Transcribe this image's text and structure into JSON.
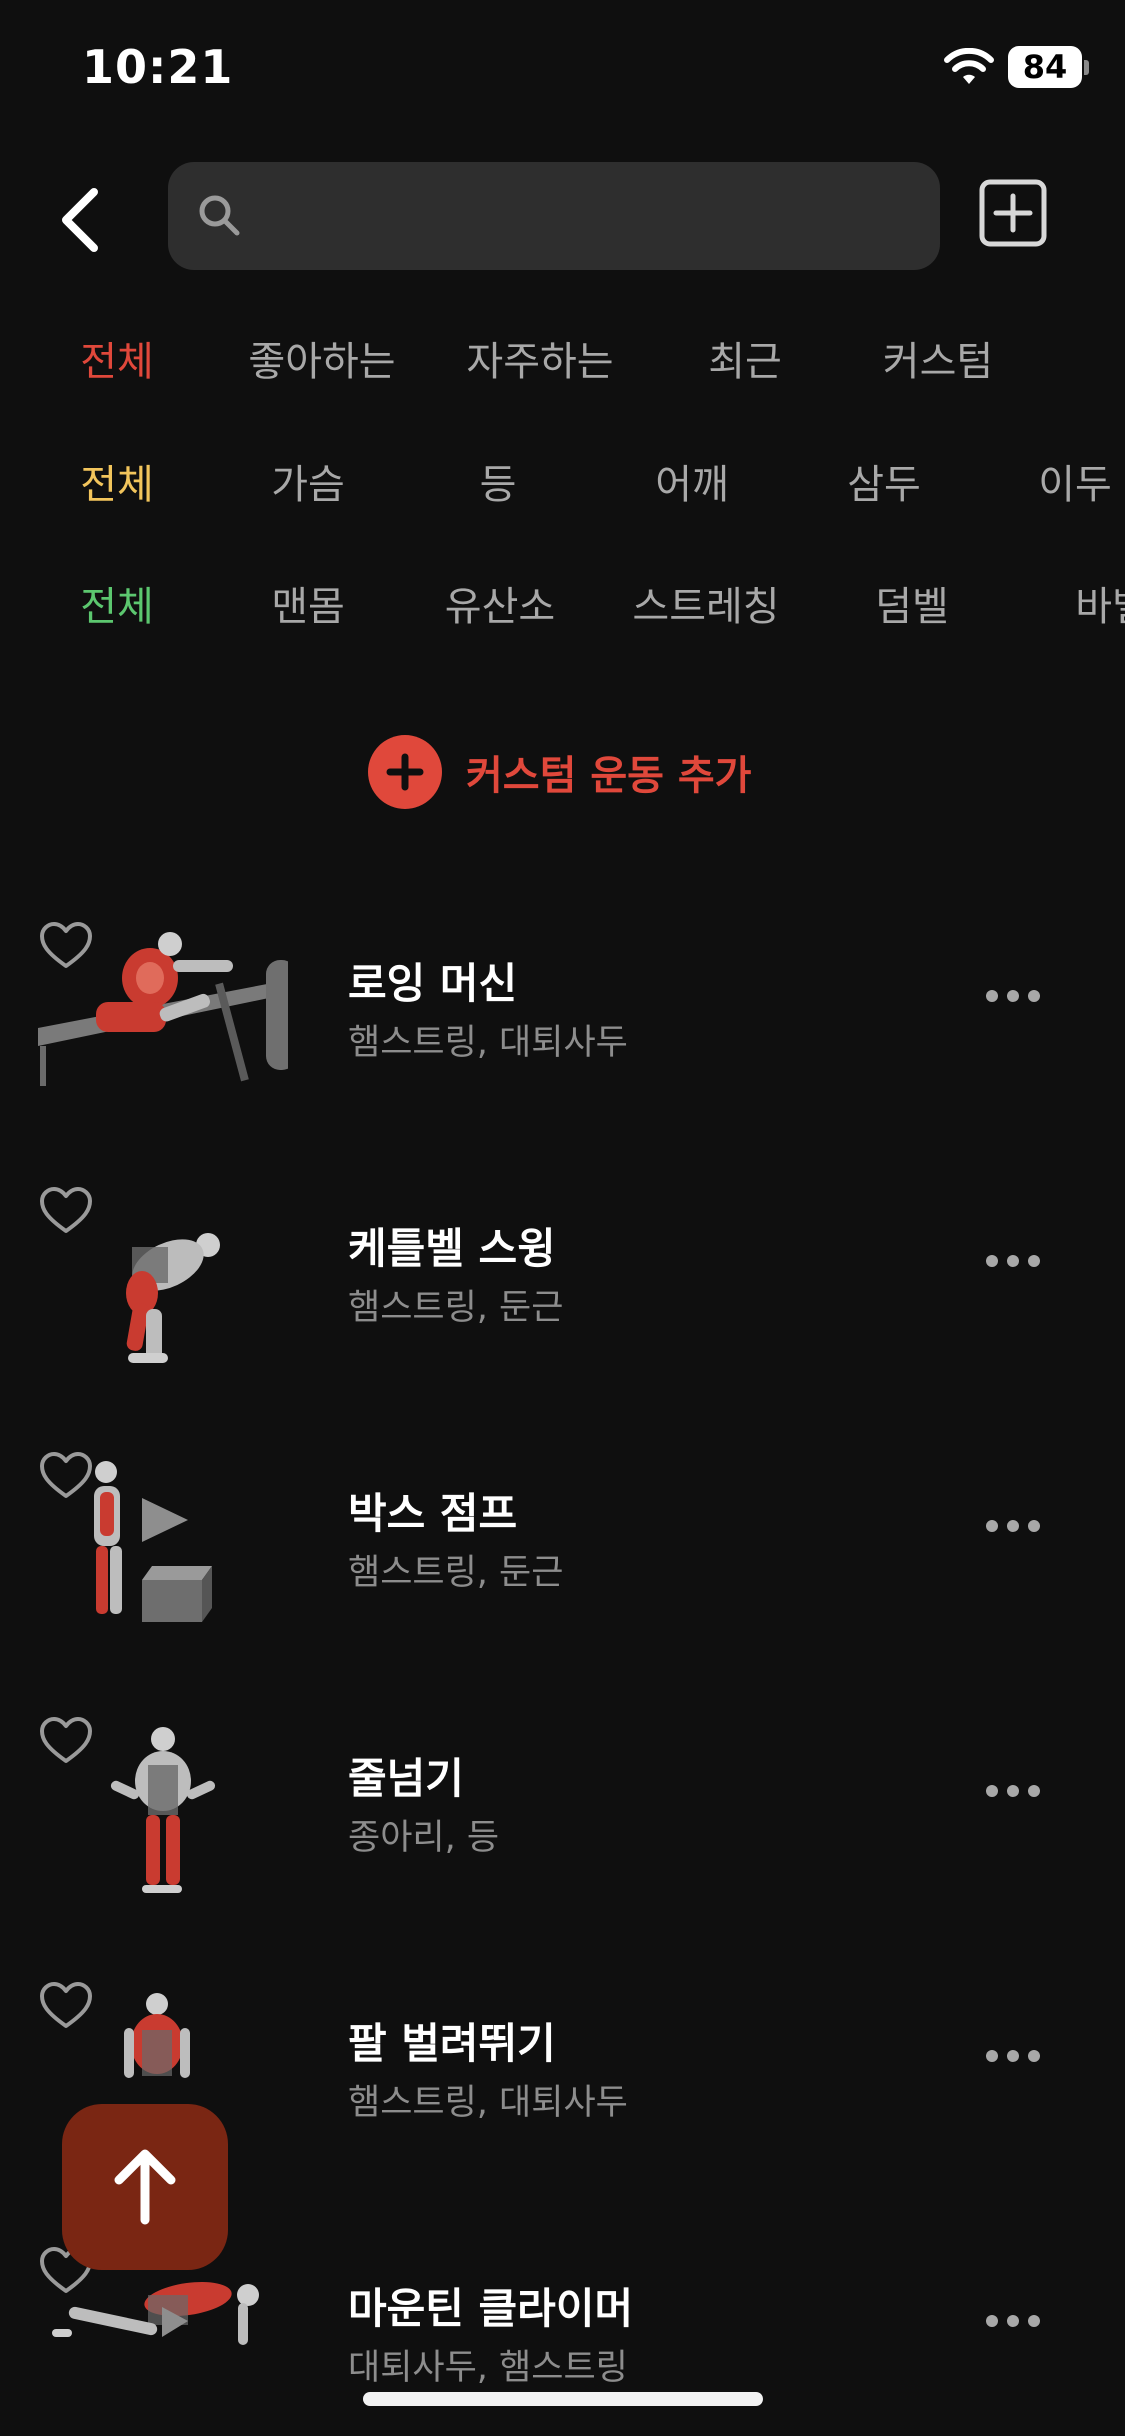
{
  "status": {
    "time": "10:21",
    "battery": "84"
  },
  "search": {
    "placeholder": ""
  },
  "filters": {
    "row1": [
      "전체",
      "좋아하는",
      "자주하는",
      "최근",
      "커스텀"
    ],
    "row2": [
      "전체",
      "가슴",
      "등",
      "어깨",
      "삼두",
      "이두"
    ],
    "row3": [
      "전체",
      "맨몸",
      "유산소",
      "스트레칭",
      "덤벨",
      "바벨"
    ]
  },
  "colors": {
    "accent_red": "#e0483b",
    "accent_yellow": "#f2c55c",
    "accent_green": "#5cc76f",
    "inactive": "#a8a8a8"
  },
  "add_custom_label": "커스텀 운동 추가",
  "exercises": [
    {
      "name": "로잉 머신",
      "muscles": "햄스트링, 대퇴사두"
    },
    {
      "name": "케틀벨 스윙",
      "muscles": "햄스트링, 둔근"
    },
    {
      "name": "박스 점프",
      "muscles": "햄스트링, 둔근"
    },
    {
      "name": "줄넘기",
      "muscles": "종아리, 등"
    },
    {
      "name": "팔 벌려뛰기",
      "muscles": "햄스트링, 대퇴사두"
    },
    {
      "name": "마운틴 클라이머",
      "muscles": "대퇴사두, 햄스트링"
    }
  ],
  "icons": {
    "back": "chevron-left-icon",
    "search": "search-icon",
    "add": "plus-square-icon",
    "favorite": "heart-outline-icon",
    "more": "ellipsis-icon",
    "scroll_top": "arrow-up-icon"
  }
}
